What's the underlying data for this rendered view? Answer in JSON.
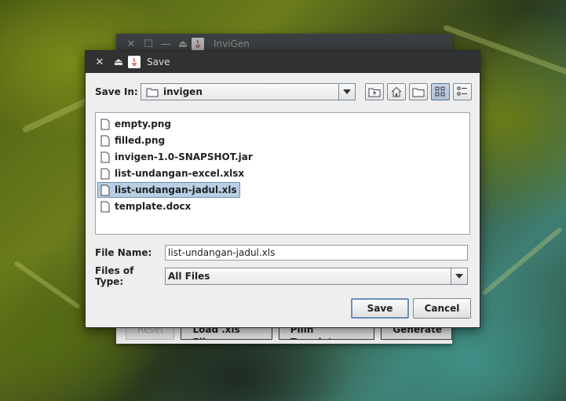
{
  "background_window": {
    "title": "InviGen",
    "buttons": [
      {
        "label": "Reset",
        "enabled": false
      },
      {
        "label": "Load .xls File",
        "enabled": true
      },
      {
        "label": "Pilih Template",
        "enabled": true
      },
      {
        "label": "Generate",
        "enabled": true
      }
    ]
  },
  "dialog": {
    "title": "Save",
    "save_in": {
      "label": "Save In:",
      "value": "invigen"
    },
    "toolbar": [
      "up-one-level",
      "home",
      "new-folder",
      "list-view",
      "details-view"
    ],
    "files": [
      {
        "name": "empty.png",
        "selected": false
      },
      {
        "name": "filled.png",
        "selected": false
      },
      {
        "name": "invigen-1.0-SNAPSHOT.jar",
        "selected": false
      },
      {
        "name": "list-undangan-excel.xlsx",
        "selected": false
      },
      {
        "name": "list-undangan-jadul.xls",
        "selected": true
      },
      {
        "name": "template.docx",
        "selected": false
      }
    ],
    "file_name": {
      "label": "File Name:",
      "value": "list-undangan-jadul.xls"
    },
    "files_of_type": {
      "label": "Files of Type:",
      "value": "All Files"
    },
    "save_label": "Save",
    "cancel_label": "Cancel"
  },
  "colors": {
    "titlebar": "#2f3133",
    "selection": "#b8cfe5",
    "dialog_bg": "#eeeeee"
  }
}
